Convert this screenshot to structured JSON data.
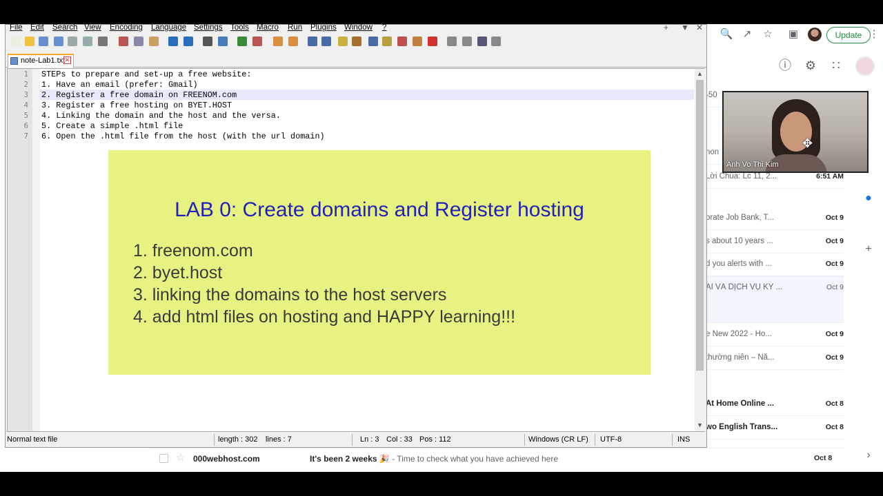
{
  "browser": {
    "update_label": "Update"
  },
  "mail_rows": [
    {
      "subject": "-50",
      "date": "",
      "bold": false
    },
    {
      "subject": "non",
      "date": "",
      "bold": false
    },
    {
      "subject": "Lời Chúa: Lc 11, 2...",
      "date": "6:51 AM",
      "bold": false
    },
    {
      "subject": "orate Job Bank, T...",
      "date": "Oct 9",
      "bold": false
    },
    {
      "subject": "s about 10 years ...",
      "date": "Oct 9",
      "bold": false
    },
    {
      "subject": "d you alerts with ...",
      "date": "Oct 9",
      "bold": false
    },
    {
      "subject": "AI VÀ DỊCH VỤ KỸ ...",
      "date": "Oct 9",
      "bold": false
    },
    {
      "subject": "e New 2022 - Ho...",
      "date": "Oct 9",
      "bold": false
    },
    {
      "subject": "thường niên – Nă...",
      "date": "Oct 9",
      "bold": false
    },
    {
      "subject": "At Home Online ...",
      "date": "Oct 8",
      "bold": true
    },
    {
      "subject": "wo English Trans...",
      "date": "Oct 8",
      "bold": true
    },
    {
      "subject": "",
      "date": "Oct 8",
      "bold": false
    }
  ],
  "bottom_mail": {
    "sender": "000webhost.com",
    "subject": "It's been 2 weeks 🎉",
    "snippet": " - Time to check what you have achieved here",
    "date": "Oct 8"
  },
  "video": {
    "participant_name": "Anh Vo Thi Kim"
  },
  "npp": {
    "menu": [
      "File",
      "Edit",
      "Search",
      "View",
      "Encoding",
      "Language",
      "Settings",
      "Tools",
      "Macro",
      "Run",
      "Plugins",
      "Window",
      "?"
    ],
    "tab_name": "note-Lab1.txt",
    "lines": [
      "STEPs to prepare and set-up a free website:",
      "1. Have an email (prefer: Gmail)",
      "2. Register a free domain on FREENOM.com",
      "3. Register a free hosting on BYET.HOST",
      "4. Linking the domain and the host and the versa.",
      "5. Create a simple .html file",
      "6. Open the .html file from the host (with the url domain)"
    ],
    "line_numbers": [
      "1",
      "2",
      "3",
      "4",
      "5",
      "6",
      "7"
    ],
    "status": {
      "file_type": "Normal text file",
      "length": "length : 302",
      "lines": "lines : 7",
      "ln": "Ln : 3",
      "col": "Col : 33",
      "pos": "Pos : 112",
      "eol": "Windows (CR LF)",
      "encoding": "UTF-8",
      "mode": "INS"
    }
  },
  "slide": {
    "title": "LAB 0: Create domains and Register hosting",
    "items": [
      "1. freenom.com",
      "2. byet.host",
      "3. linking the domains to the host servers",
      "4. add html files on hosting and HAPPY learning!!!"
    ]
  }
}
